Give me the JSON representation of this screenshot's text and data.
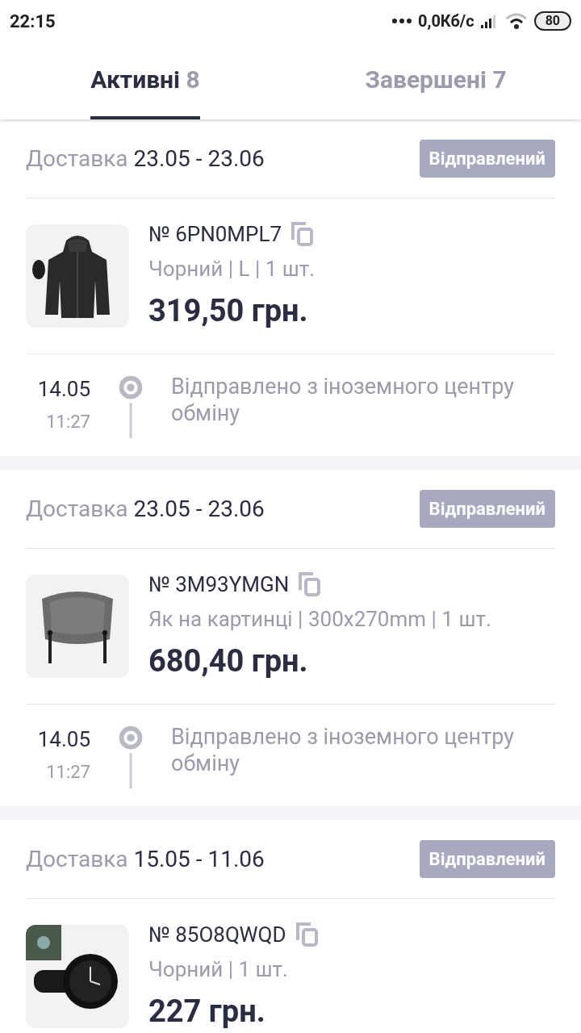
{
  "status_bar": {
    "time": "22:15",
    "network_speed": "0,0Кб/с",
    "battery": "80"
  },
  "tabs": [
    {
      "label": "Активні",
      "count": "8",
      "selected": true
    },
    {
      "label": "Завершені",
      "count": "7",
      "selected": false
    }
  ],
  "orders": [
    {
      "delivery_label": "Доставка",
      "delivery_dates": "23.05 - 23.06",
      "status": "Відправлений",
      "number": "№ 6PN0MPL7",
      "details": "Чорний | L | 1 шт.",
      "price": "319,50 грн.",
      "image": {
        "kind": "picture"
      },
      "events": [
        {
          "date": "14.05",
          "time": "11:27",
          "text": "Відправлено з іноземного центру обміну"
        }
      ]
    },
    {
      "delivery_label": "Доставка",
      "delivery_dates": "23.05 - 23.06",
      "status": "Відправлений",
      "number": "№ 3M93YMGN",
      "details": "Як на картинці | 300x270mm | 1 шт.",
      "price": "680,40 грн.",
      "image": {
        "kind": "picture"
      },
      "events": [
        {
          "date": "14.05",
          "time": "11:27",
          "text": "Відправлено з іноземного центру обміну"
        }
      ]
    },
    {
      "delivery_label": "Доставка",
      "delivery_dates": "15.05 - 11.06",
      "status": "Відправлений",
      "number": "№ 85O8QWQD",
      "details": "Чорний | 1 шт.",
      "price": "227 грн.",
      "image": {
        "kind": "picture"
      }
    }
  ]
}
